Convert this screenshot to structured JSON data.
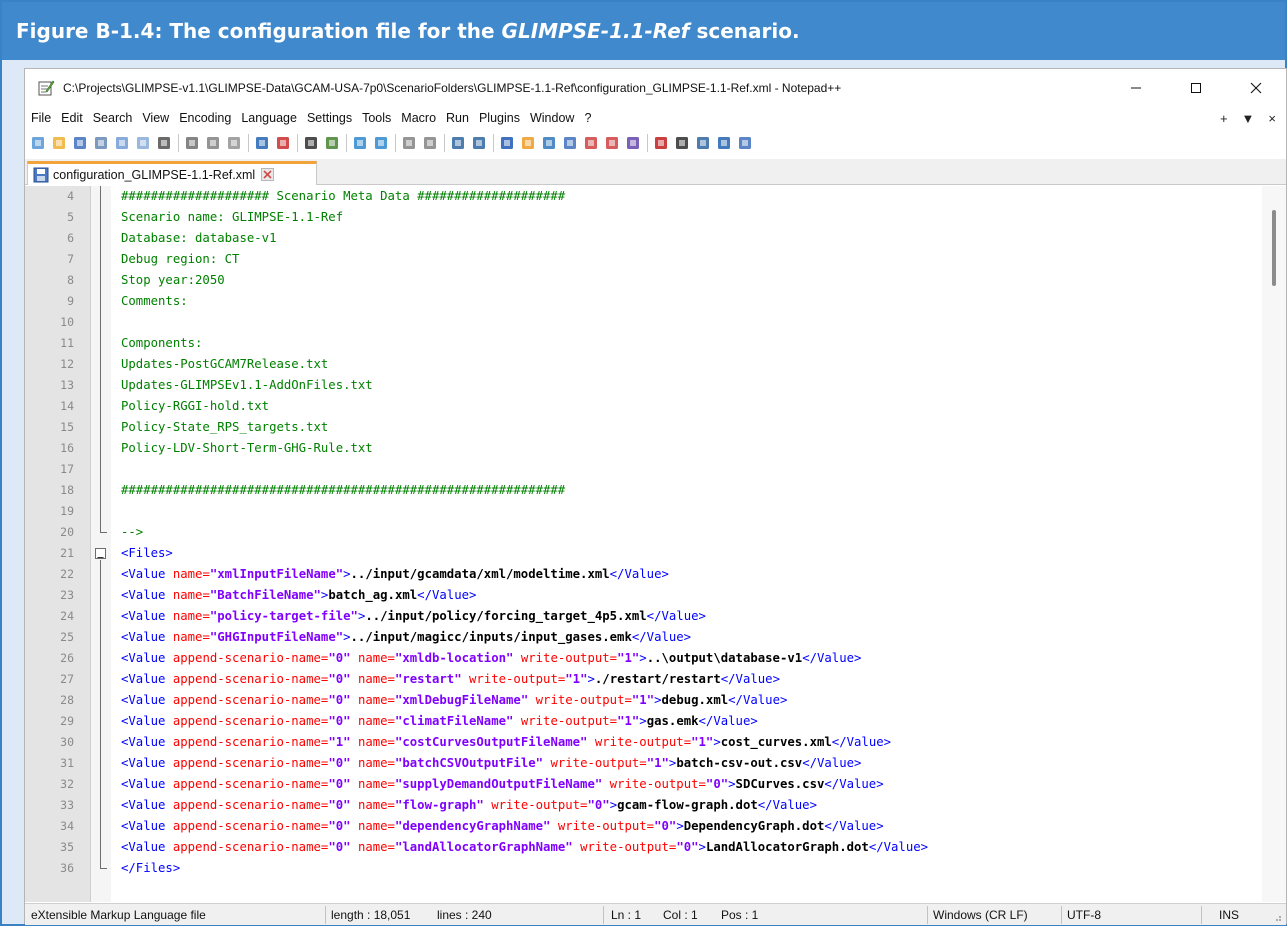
{
  "figure": {
    "caption_prefix": "Figure B-1.4: The configuration file for the ",
    "caption_italic": "GLIMPSE-1.1-Ref",
    "caption_suffix": " scenario."
  },
  "window": {
    "title": "C:\\Projects\\GLIMPSE-v1.1\\GLIMPSE-Data\\GCAM-USA-7p0\\ScenarioFolders\\GLIMPSE-1.1-Ref\\configuration_GLIMPSE-1.1-Ref.xml - Notepad++"
  },
  "menu": {
    "items": [
      "File",
      "Edit",
      "Search",
      "View",
      "Encoding",
      "Language",
      "Settings",
      "Tools",
      "Macro",
      "Run",
      "Plugins",
      "Window",
      "?"
    ],
    "right": [
      "+",
      "▼",
      "×"
    ]
  },
  "toolbar": {
    "icons": [
      "new-file-icon",
      "open-file-icon",
      "save-icon",
      "save-all-icon",
      "close-icon",
      "close-all-icon",
      "print-icon",
      "cut-icon",
      "copy-icon",
      "paste-icon",
      "undo-icon",
      "redo-icon",
      "find-icon",
      "replace-icon",
      "zoom-in-icon",
      "zoom-out-icon",
      "sync-vertical-icon",
      "sync-horizontal-icon",
      "word-wrap-icon",
      "show-all-characters-icon",
      "indent-guide-icon",
      "user-language-icon",
      "doc-map-icon",
      "function-list-icon",
      "folder-as-workspace-icon",
      "doc-list-icon",
      "monitoring-icon",
      "record-macro-icon",
      "stop-macro-icon",
      "play-macro-icon",
      "run-macro-multiple-icon",
      "save-macro-icon"
    ]
  },
  "tab": {
    "label": "configuration_GLIMPSE-1.1-Ref.xml"
  },
  "editor": {
    "lines": [
      {
        "n": "4",
        "segments": [
          {
            "t": "#################### Scenario Meta Data ####################",
            "c": "c-comment"
          }
        ]
      },
      {
        "n": "5",
        "segments": [
          {
            "t": "Scenario name: GLIMPSE-1.1-Ref",
            "c": "c-comment"
          }
        ]
      },
      {
        "n": "6",
        "segments": [
          {
            "t": "Database: database-v1",
            "c": "c-comment"
          }
        ]
      },
      {
        "n": "7",
        "segments": [
          {
            "t": "Debug region: CT",
            "c": "c-comment"
          }
        ]
      },
      {
        "n": "8",
        "segments": [
          {
            "t": "Stop year:2050",
            "c": "c-comment"
          }
        ]
      },
      {
        "n": "9",
        "segments": [
          {
            "t": "Comments:",
            "c": "c-comment"
          }
        ]
      },
      {
        "n": "10",
        "segments": []
      },
      {
        "n": "11",
        "segments": [
          {
            "t": "Components:",
            "c": "c-comment"
          }
        ]
      },
      {
        "n": "12",
        "segments": [
          {
            "t": "Updates-PostGCAM7Release.txt",
            "c": "c-comment"
          }
        ]
      },
      {
        "n": "13",
        "segments": [
          {
            "t": "Updates-GLIMPSEv1.1-AddOnFiles.txt",
            "c": "c-comment"
          }
        ]
      },
      {
        "n": "14",
        "segments": [
          {
            "t": "Policy-RGGI-hold.txt",
            "c": "c-comment"
          }
        ]
      },
      {
        "n": "15",
        "segments": [
          {
            "t": "Policy-State_RPS_targets.txt",
            "c": "c-comment"
          }
        ]
      },
      {
        "n": "16",
        "segments": [
          {
            "t": "Policy-LDV-Short-Term-GHG-Rule.txt",
            "c": "c-comment"
          }
        ]
      },
      {
        "n": "17",
        "segments": []
      },
      {
        "n": "18",
        "segments": [
          {
            "t": "############################################################",
            "c": "c-comment"
          }
        ]
      },
      {
        "n": "19",
        "segments": []
      },
      {
        "n": "20",
        "segments": [
          {
            "t": "-->",
            "c": "c-comment"
          }
        ]
      },
      {
        "n": "21",
        "segments": [
          {
            "t": "<Files>",
            "c": "c-tag"
          }
        ]
      },
      {
        "n": "22",
        "segments": [
          {
            "t": "<Value ",
            "c": "c-tag"
          },
          {
            "t": "name=",
            "c": "c-attr"
          },
          {
            "t": "\"xmlInputFileName\"",
            "c": "c-val"
          },
          {
            "t": ">",
            "c": "c-tag"
          },
          {
            "t": "../input/gcamdata/xml/modeltime.xml",
            "c": "c-text"
          },
          {
            "t": "</Value>",
            "c": "c-tag"
          }
        ]
      },
      {
        "n": "23",
        "segments": [
          {
            "t": "<Value ",
            "c": "c-tag"
          },
          {
            "t": "name=",
            "c": "c-attr"
          },
          {
            "t": "\"BatchFileName\"",
            "c": "c-val"
          },
          {
            "t": ">",
            "c": "c-tag"
          },
          {
            "t": "batch_ag.xml",
            "c": "c-text"
          },
          {
            "t": "</Value>",
            "c": "c-tag"
          }
        ]
      },
      {
        "n": "24",
        "segments": [
          {
            "t": "<Value ",
            "c": "c-tag"
          },
          {
            "t": "name=",
            "c": "c-attr"
          },
          {
            "t": "\"policy-target-file\"",
            "c": "c-val"
          },
          {
            "t": ">",
            "c": "c-tag"
          },
          {
            "t": "../input/policy/forcing_target_4p5.xml",
            "c": "c-text"
          },
          {
            "t": "</Value>",
            "c": "c-tag"
          }
        ]
      },
      {
        "n": "25",
        "segments": [
          {
            "t": "<Value ",
            "c": "c-tag"
          },
          {
            "t": "name=",
            "c": "c-attr"
          },
          {
            "t": "\"GHGInputFileName\"",
            "c": "c-val"
          },
          {
            "t": ">",
            "c": "c-tag"
          },
          {
            "t": "../input/magicc/inputs/input_gases.emk",
            "c": "c-text"
          },
          {
            "t": "</Value>",
            "c": "c-tag"
          }
        ]
      },
      {
        "n": "26",
        "segments": [
          {
            "t": "<Value ",
            "c": "c-tag"
          },
          {
            "t": "append-scenario-name=",
            "c": "c-attr"
          },
          {
            "t": "\"0\" ",
            "c": "c-val"
          },
          {
            "t": "name=",
            "c": "c-attr"
          },
          {
            "t": "\"xmldb-location\" ",
            "c": "c-val"
          },
          {
            "t": "write-output=",
            "c": "c-attr"
          },
          {
            "t": "\"1\"",
            "c": "c-val"
          },
          {
            "t": ">",
            "c": "c-tag"
          },
          {
            "t": "..\\output\\database-v1",
            "c": "c-text"
          },
          {
            "t": "</Value>",
            "c": "c-tag"
          }
        ]
      },
      {
        "n": "27",
        "segments": [
          {
            "t": "<Value ",
            "c": "c-tag"
          },
          {
            "t": "append-scenario-name=",
            "c": "c-attr"
          },
          {
            "t": "\"0\" ",
            "c": "c-val"
          },
          {
            "t": "name=",
            "c": "c-attr"
          },
          {
            "t": "\"restart\" ",
            "c": "c-val"
          },
          {
            "t": "write-output=",
            "c": "c-attr"
          },
          {
            "t": "\"1\"",
            "c": "c-val"
          },
          {
            "t": ">",
            "c": "c-tag"
          },
          {
            "t": "./restart/restart",
            "c": "c-text"
          },
          {
            "t": "</Value>",
            "c": "c-tag"
          }
        ]
      },
      {
        "n": "28",
        "segments": [
          {
            "t": "<Value ",
            "c": "c-tag"
          },
          {
            "t": "append-scenario-name=",
            "c": "c-attr"
          },
          {
            "t": "\"0\" ",
            "c": "c-val"
          },
          {
            "t": "name=",
            "c": "c-attr"
          },
          {
            "t": "\"xmlDebugFileName\" ",
            "c": "c-val"
          },
          {
            "t": "write-output=",
            "c": "c-attr"
          },
          {
            "t": "\"1\"",
            "c": "c-val"
          },
          {
            "t": ">",
            "c": "c-tag"
          },
          {
            "t": "debug.xml",
            "c": "c-text"
          },
          {
            "t": "</Value>",
            "c": "c-tag"
          }
        ]
      },
      {
        "n": "29",
        "segments": [
          {
            "t": "<Value ",
            "c": "c-tag"
          },
          {
            "t": "append-scenario-name=",
            "c": "c-attr"
          },
          {
            "t": "\"0\" ",
            "c": "c-val"
          },
          {
            "t": "name=",
            "c": "c-attr"
          },
          {
            "t": "\"climatFileName\" ",
            "c": "c-val"
          },
          {
            "t": "write-output=",
            "c": "c-attr"
          },
          {
            "t": "\"1\"",
            "c": "c-val"
          },
          {
            "t": ">",
            "c": "c-tag"
          },
          {
            "t": "gas.emk",
            "c": "c-text"
          },
          {
            "t": "</Value>",
            "c": "c-tag"
          }
        ]
      },
      {
        "n": "30",
        "segments": [
          {
            "t": "<Value ",
            "c": "c-tag"
          },
          {
            "t": "append-scenario-name=",
            "c": "c-attr"
          },
          {
            "t": "\"1\" ",
            "c": "c-val"
          },
          {
            "t": "name=",
            "c": "c-attr"
          },
          {
            "t": "\"costCurvesOutputFileName\" ",
            "c": "c-val"
          },
          {
            "t": "write-output=",
            "c": "c-attr"
          },
          {
            "t": "\"1\"",
            "c": "c-val"
          },
          {
            "t": ">",
            "c": "c-tag"
          },
          {
            "t": "cost_curves.xml",
            "c": "c-text"
          },
          {
            "t": "</Value>",
            "c": "c-tag"
          }
        ]
      },
      {
        "n": "31",
        "segments": [
          {
            "t": "<Value ",
            "c": "c-tag"
          },
          {
            "t": "append-scenario-name=",
            "c": "c-attr"
          },
          {
            "t": "\"0\" ",
            "c": "c-val"
          },
          {
            "t": "name=",
            "c": "c-attr"
          },
          {
            "t": "\"batchCSVOutputFile\" ",
            "c": "c-val"
          },
          {
            "t": "write-output=",
            "c": "c-attr"
          },
          {
            "t": "\"1\"",
            "c": "c-val"
          },
          {
            "t": ">",
            "c": "c-tag"
          },
          {
            "t": "batch-csv-out.csv",
            "c": "c-text"
          },
          {
            "t": "</Value>",
            "c": "c-tag"
          }
        ]
      },
      {
        "n": "32",
        "segments": [
          {
            "t": "<Value ",
            "c": "c-tag"
          },
          {
            "t": "append-scenario-name=",
            "c": "c-attr"
          },
          {
            "t": "\"0\" ",
            "c": "c-val"
          },
          {
            "t": "name=",
            "c": "c-attr"
          },
          {
            "t": "\"supplyDemandOutputFileName\" ",
            "c": "c-val"
          },
          {
            "t": "write-output=",
            "c": "c-attr"
          },
          {
            "t": "\"0\"",
            "c": "c-val"
          },
          {
            "t": ">",
            "c": "c-tag"
          },
          {
            "t": "SDCurves.csv",
            "c": "c-text"
          },
          {
            "t": "</Value>",
            "c": "c-tag"
          }
        ]
      },
      {
        "n": "33",
        "segments": [
          {
            "t": "<Value ",
            "c": "c-tag"
          },
          {
            "t": "append-scenario-name=",
            "c": "c-attr"
          },
          {
            "t": "\"0\" ",
            "c": "c-val"
          },
          {
            "t": "name=",
            "c": "c-attr"
          },
          {
            "t": "\"flow-graph\" ",
            "c": "c-val"
          },
          {
            "t": "write-output=",
            "c": "c-attr"
          },
          {
            "t": "\"0\"",
            "c": "c-val"
          },
          {
            "t": ">",
            "c": "c-tag"
          },
          {
            "t": "gcam-flow-graph.dot",
            "c": "c-text"
          },
          {
            "t": "</Value>",
            "c": "c-tag"
          }
        ]
      },
      {
        "n": "34",
        "segments": [
          {
            "t": "<Value ",
            "c": "c-tag"
          },
          {
            "t": "append-scenario-name=",
            "c": "c-attr"
          },
          {
            "t": "\"0\" ",
            "c": "c-val"
          },
          {
            "t": "name=",
            "c": "c-attr"
          },
          {
            "t": "\"dependencyGraphName\" ",
            "c": "c-val"
          },
          {
            "t": "write-output=",
            "c": "c-attr"
          },
          {
            "t": "\"0\"",
            "c": "c-val"
          },
          {
            "t": ">",
            "c": "c-tag"
          },
          {
            "t": "DependencyGraph.dot",
            "c": "c-text"
          },
          {
            "t": "</Value>",
            "c": "c-tag"
          }
        ]
      },
      {
        "n": "35",
        "segments": [
          {
            "t": "<Value ",
            "c": "c-tag"
          },
          {
            "t": "append-scenario-name=",
            "c": "c-attr"
          },
          {
            "t": "\"0\" ",
            "c": "c-val"
          },
          {
            "t": "name=",
            "c": "c-attr"
          },
          {
            "t": "\"landAllocatorGraphName\" ",
            "c": "c-val"
          },
          {
            "t": "write-output=",
            "c": "c-attr"
          },
          {
            "t": "\"0\"",
            "c": "c-val"
          },
          {
            "t": ">",
            "c": "c-tag"
          },
          {
            "t": "LandAllocatorGraph.dot",
            "c": "c-text"
          },
          {
            "t": "</Value>",
            "c": "c-tag"
          }
        ]
      },
      {
        "n": "36",
        "segments": [
          {
            "t": "</Files>",
            "c": "c-tag"
          }
        ]
      }
    ]
  },
  "status": {
    "file_type": "eXtensible Markup Language file",
    "length": "length : 18,051",
    "lines": "lines : 240",
    "ln": "Ln : 1",
    "col": "Col : 1",
    "pos": "Pos : 1",
    "eol": "Windows (CR LF)",
    "encoding": "UTF-8",
    "mode": "INS"
  }
}
